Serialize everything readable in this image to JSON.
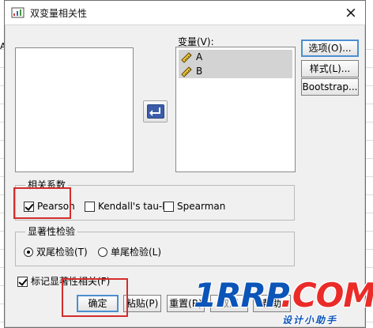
{
  "background": {
    "side_label": "A"
  },
  "dialog": {
    "title": "双变量相关性",
    "close_symbol": "×",
    "variables_label": "变量(V):",
    "variables": [
      {
        "name": "A"
      },
      {
        "name": "B"
      }
    ],
    "side_buttons": {
      "options": "选项(O)...",
      "style": "样式(L)...",
      "bootstrap": "Bootstrap..."
    },
    "correlation_group": {
      "title": "相关系数",
      "options": [
        {
          "label": "Pearson",
          "checked": true
        },
        {
          "label": "Kendall's tau-b",
          "checked": false
        },
        {
          "label": "Spearman",
          "checked": false
        }
      ]
    },
    "significance_group": {
      "title": "显著性检验",
      "options": [
        {
          "label": "双尾检验(T)",
          "selected": true
        },
        {
          "label": "单尾检验(L)",
          "selected": false
        }
      ]
    },
    "flag_option": {
      "label": "标记显著性相关(F)",
      "checked": true
    },
    "bottom_buttons": {
      "ok": "确定",
      "paste": "粘贴(P)",
      "reset": "重置(R)",
      "cancel": "取消",
      "help": "帮助"
    }
  },
  "watermark": {
    "main_blue": "1RRP",
    "main_red": ".COM",
    "subtitle": "设计小助手",
    "colors": {
      "blue": "#0b54b8",
      "red": "#ea2b28"
    }
  },
  "highlight_color": "#d42c2c",
  "accent_button_border": "#4b8fd1"
}
